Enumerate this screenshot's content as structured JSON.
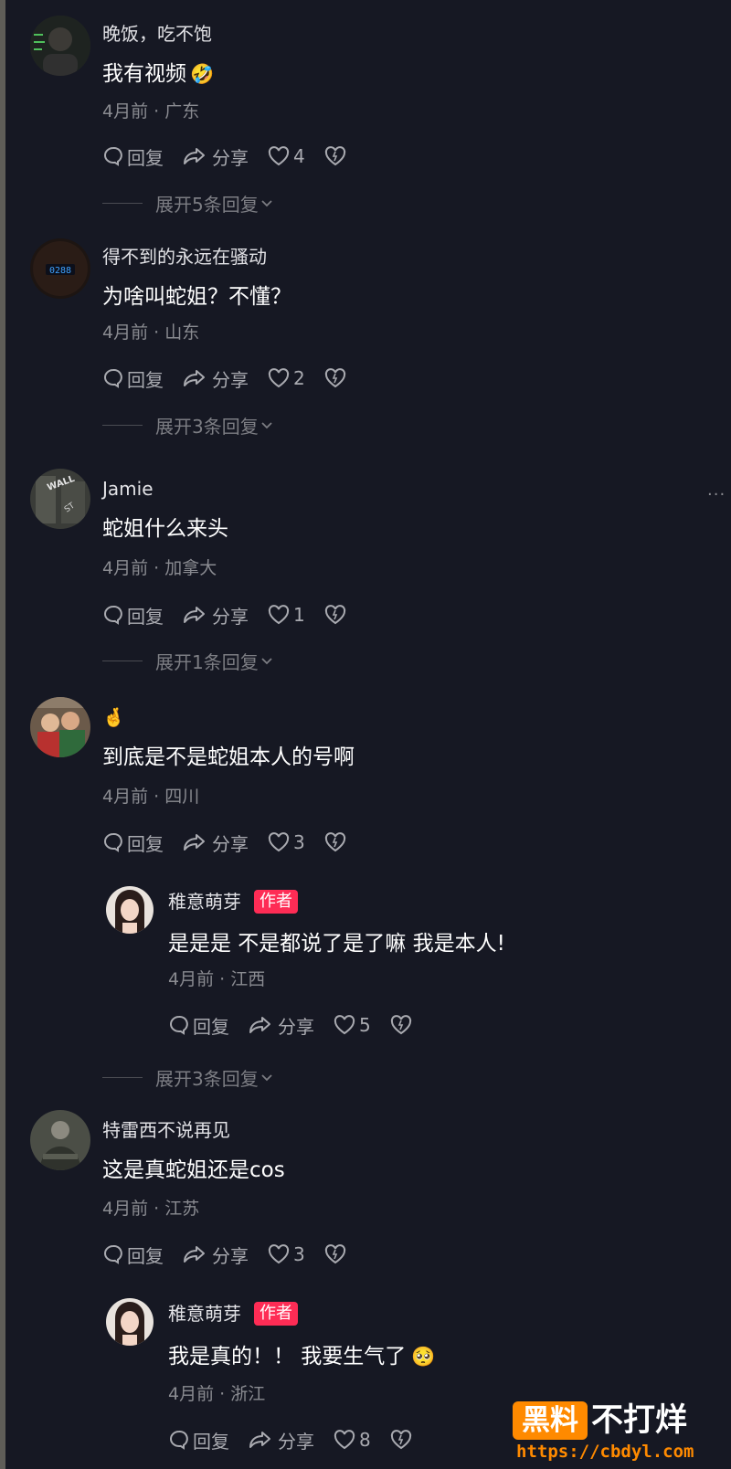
{
  "comments": [
    {
      "user": "晚饭，吃不饱",
      "text": "我有视频",
      "emoji": "🤣",
      "time": "4月前",
      "location": "广东",
      "reply_label": "回复",
      "share_label": "分享",
      "likes": "4",
      "expand": "展开5条回复"
    },
    {
      "user": "得不到的永远在骚动",
      "text": "为啥叫蛇姐？不懂？",
      "time": "4月前",
      "location": "山东",
      "reply_label": "回复",
      "share_label": "分享",
      "likes": "2",
      "expand": "展开3条回复"
    },
    {
      "user": "Jamie",
      "text": "蛇姐什么来头",
      "time": "4月前",
      "location": "加拿大",
      "reply_label": "回复",
      "share_label": "分享",
      "likes": "1",
      "expand": "展开1条回复",
      "more": "···"
    },
    {
      "user": "🤞",
      "text": "到底是不是蛇姐本人的号啊",
      "time": "4月前",
      "location": "四川",
      "reply_label": "回复",
      "share_label": "分享",
      "likes": "3",
      "reply": {
        "user": "稚意萌芽",
        "tag": "作者",
        "text": "是是是 不是都说了是了嘛 我是本人!",
        "time": "4月前",
        "location": "江西",
        "reply_label": "回复",
        "share_label": "分享",
        "likes": "5"
      },
      "expand": "展开3条回复"
    },
    {
      "user": "特雷西不说再见",
      "text": "这是真蛇姐还是cos",
      "time": "4月前",
      "location": "江苏",
      "reply_label": "回复",
      "share_label": "分享",
      "likes": "3",
      "reply": {
        "user": "稚意萌芽",
        "tag": "作者",
        "text": "我是真的！！ 我要生气了",
        "emoji": "🥺",
        "time": "4月前",
        "location": "浙江",
        "reply_label": "回复",
        "share_label": "分享",
        "likes": "8"
      }
    }
  ],
  "separator": " · ",
  "watermark": {
    "box": "黑料",
    "text": "不打烊",
    "url": "https://cbdyl.com"
  },
  "colors": {
    "background": "#161823",
    "author_tag": "#fe2c55",
    "watermark": "#ff8a00"
  }
}
